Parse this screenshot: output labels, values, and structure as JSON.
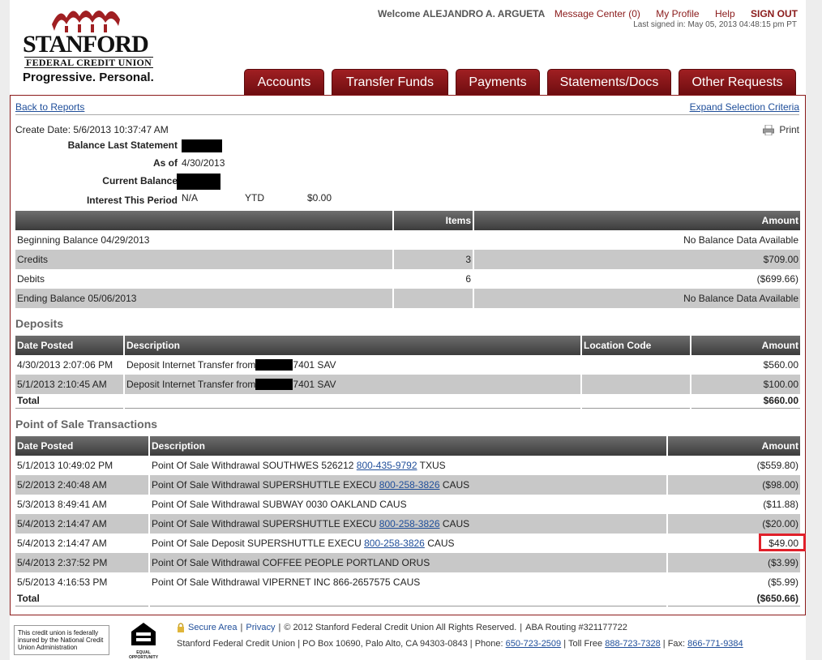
{
  "brand": {
    "name": "STANFORD",
    "sub": "FEDERAL CREDIT UNION",
    "tagline": "Progressive. Personal.",
    "accent": "#8b1a1a"
  },
  "header": {
    "welcome": "Welcome ALEJANDRO A. ARGUETA",
    "links": {
      "message_center": "Message Center (0)",
      "my_profile": "My Profile",
      "help": "Help",
      "sign_out": "SIGN OUT"
    },
    "last_signed": "Last signed in: May 05, 2013 04:48:15 pm PT"
  },
  "tabs": [
    "Accounts",
    "Transfer Funds",
    "Payments",
    "Statements/Docs",
    "Other Requests"
  ],
  "nav": {
    "back": "Back to Reports",
    "expand": "Expand Selection Criteria",
    "print": "Print"
  },
  "report": {
    "create_date": "Create Date: 5/6/2013 10:37:47 AM",
    "balance_last_statement_label": "Balance Last Statement",
    "as_of_label": "As of",
    "as_of_value": "4/30/2013",
    "current_balance_label": "Current Balance",
    "interest_label": "Interest This Period",
    "interest_value": "N/A",
    "ytd_label": "YTD",
    "ytd_value": "$0.00"
  },
  "summary": {
    "headers": [
      "",
      "Items",
      "Amount"
    ],
    "rows": [
      [
        "Beginning Balance 04/29/2013",
        "",
        "No Balance Data Available"
      ],
      [
        "Credits",
        "3",
        "$709.00"
      ],
      [
        "Debits",
        "6",
        "($699.66)"
      ],
      [
        "Ending Balance 05/06/2013",
        "",
        "No Balance Data Available"
      ]
    ]
  },
  "deposits": {
    "title": "Deposits",
    "headers": [
      "Date Posted",
      "Description",
      "Location Code",
      "Amount"
    ],
    "rows": [
      {
        "date": "4/30/2013 2:07:06 PM",
        "desc_pre": "Deposit Internet Transfer from",
        "desc_post": "7401 SAV",
        "loc": "",
        "amount": "$560.00"
      },
      {
        "date": "5/1/2013 2:10:45 AM",
        "desc_pre": "Deposit Internet Transfer from",
        "desc_post": "7401 SAV",
        "loc": "",
        "amount": "$100.00"
      }
    ],
    "total_label": "Total",
    "total": "$660.00"
  },
  "pos": {
    "title": "Point of Sale Transactions",
    "headers": [
      "Date Posted",
      "Description",
      "Amount"
    ],
    "rows": [
      {
        "date": "5/1/2013 10:49:02 PM",
        "pre": "Point Of Sale Withdrawal SOUTHWES 526212",
        "phone": "800-435-9792",
        "post": "TXUS",
        "amount": "($559.80)"
      },
      {
        "date": "5/2/2013 2:40:48 AM",
        "pre": "Point Of Sale Withdrawal SUPERSHUTTLE EXECU",
        "phone": "800-258-3826",
        "post": "CAUS",
        "amount": "($98.00)"
      },
      {
        "date": "5/3/2013 8:49:41 AM",
        "pre": "Point Of Sale Withdrawal SUBWAY 0030 OAKLAND CAUS",
        "phone": "",
        "post": "",
        "amount": "($11.88)"
      },
      {
        "date": "5/4/2013 2:14:47 AM",
        "pre": "Point Of Sale Withdrawal SUPERSHUTTLE EXECU",
        "phone": "800-258-3826",
        "post": "CAUS",
        "amount": "($20.00)"
      },
      {
        "date": "5/4/2013 2:14:47 AM",
        "pre": "Point Of Sale Deposit SUPERSHUTTLE EXECU",
        "phone": "800-258-3826",
        "post": "CAUS",
        "amount": "$49.00"
      },
      {
        "date": "5/4/2013 2:37:52 PM",
        "pre": "Point Of Sale Withdrawal COFFEE PEOPLE PORTLAND ORUS",
        "phone": "",
        "post": "",
        "amount": "($3.99)"
      },
      {
        "date": "5/5/2013 4:16:53 PM",
        "pre": "Point Of Sale Withdrawal VIPERNET INC 866-2657575 CAUS",
        "phone": "",
        "post": "",
        "amount": "($5.99)"
      }
    ],
    "total_label": "Total",
    "total": "($650.66)"
  },
  "footer": {
    "ncua": "This credit union is federally insured by the National Credit Union Administration",
    "eho": "EQUAL OPPORTUNITY LENDER",
    "secure": "Secure Area",
    "privacy": "Privacy",
    "copyright": "© 2012 Stanford Federal Credit Union All Rights Reserved.",
    "routing": "ABA Routing #321177722",
    "address": "Stanford Federal Credit Union  |  PO Box 10690, Palo Alto, CA 94303-0843  |  Phone:",
    "phone": "650-723-2509",
    "tollfree_label": "|  Toll Free",
    "tollfree": "888-723-7328",
    "fax_label": "| Fax:",
    "fax": "866-771-9384"
  }
}
